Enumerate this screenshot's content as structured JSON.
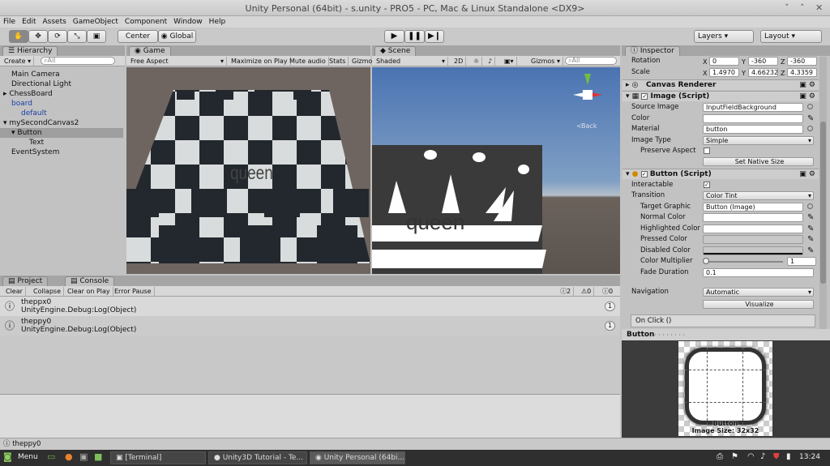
{
  "window": {
    "title": "Unity Personal (64bit) - s.unity - PRO5 - PC, Mac & Linux Standalone <DX9>"
  },
  "menu": [
    "File",
    "Edit",
    "Assets",
    "GameObject",
    "Component",
    "Window",
    "Help"
  ],
  "toolbar": {
    "center": "Center",
    "global": "Global",
    "layers": "Layers",
    "layout": "Layout"
  },
  "hierarchy": {
    "tab": "Hierarchy",
    "create": "Create",
    "search": "All",
    "items": [
      "Main Camera",
      "Directional Light",
      "ChessBoard",
      "board",
      "default",
      "mySecondCanvas2",
      "Button",
      "Text",
      "EventSystem"
    ]
  },
  "game": {
    "tab": "Game",
    "aspect": "Free Aspect",
    "maximize": "Maximize on Play",
    "mute": "Mute audio",
    "stats": "Stats",
    "gizmos": "Gizmo",
    "label": "queen"
  },
  "scene": {
    "tab": "Scene",
    "shading": "Shaded",
    "mode2d": "2D",
    "gizmos": "Gizmos",
    "search": "All",
    "back": "Back",
    "label": "queen"
  },
  "inspector": {
    "tab": "Inspector",
    "rotation": {
      "label": "Rotation",
      "x": "0",
      "y": "-360",
      "z": "-360"
    },
    "scale": {
      "label": "Scale",
      "x": "1.4970",
      "y": "4.66232",
      "z": "4.3359"
    },
    "canvas_renderer": "Canvas Renderer",
    "image": {
      "title": "Image (Script)",
      "source_label": "Source Image",
      "source": "InputFieldBackground",
      "color_label": "Color",
      "material_label": "Material",
      "material": "button",
      "type_label": "Image Type",
      "type": "Simple",
      "preserve": "Preserve Aspect",
      "native": "Set Native Size"
    },
    "button": {
      "title": "Button (Script)",
      "interactable": "Interactable",
      "transition_label": "Transition",
      "transition": "Color Tint",
      "target_label": "Target Graphic",
      "target": "Button (Image)",
      "normal": "Normal Color",
      "highlighted": "Highlighted Color",
      "pressed": "Pressed Color",
      "disabled": "Disabled Color",
      "multiplier_label": "Color Multiplier",
      "multiplier": "1",
      "fade_label": "Fade Duration",
      "fade": "0.1",
      "nav_label": "Navigation",
      "nav": "Automatic",
      "visualize": "Visualize",
      "onclick": "On Click ()"
    },
    "preview": {
      "title": "Button",
      "caption": "Button",
      "size": "Image Size: 32x32"
    }
  },
  "console": {
    "project_tab": "Project",
    "console_tab": "Console",
    "clear": "Clear",
    "collapse": "Collapse",
    "clear_on_play": "Clear on Play",
    "error_pause": "Error Pause",
    "count_warn": "2",
    "count_err": "0",
    "count_log": "0",
    "entries": [
      {
        "line1": "theppx0",
        "line2": "UnityEngine.Debug:Log(Object)",
        "count": "1"
      },
      {
        "line1": "theppy0",
        "line2": "UnityEngine.Debug:Log(Object)",
        "count": "1"
      }
    ],
    "status": "theppy0"
  },
  "taskbar": {
    "menu": "Menu",
    "t1": "[Terminal]",
    "t2": "Unity3D Tutorial - Te...",
    "t3": "Unity Personal (64bi...",
    "clock": "13:24"
  }
}
